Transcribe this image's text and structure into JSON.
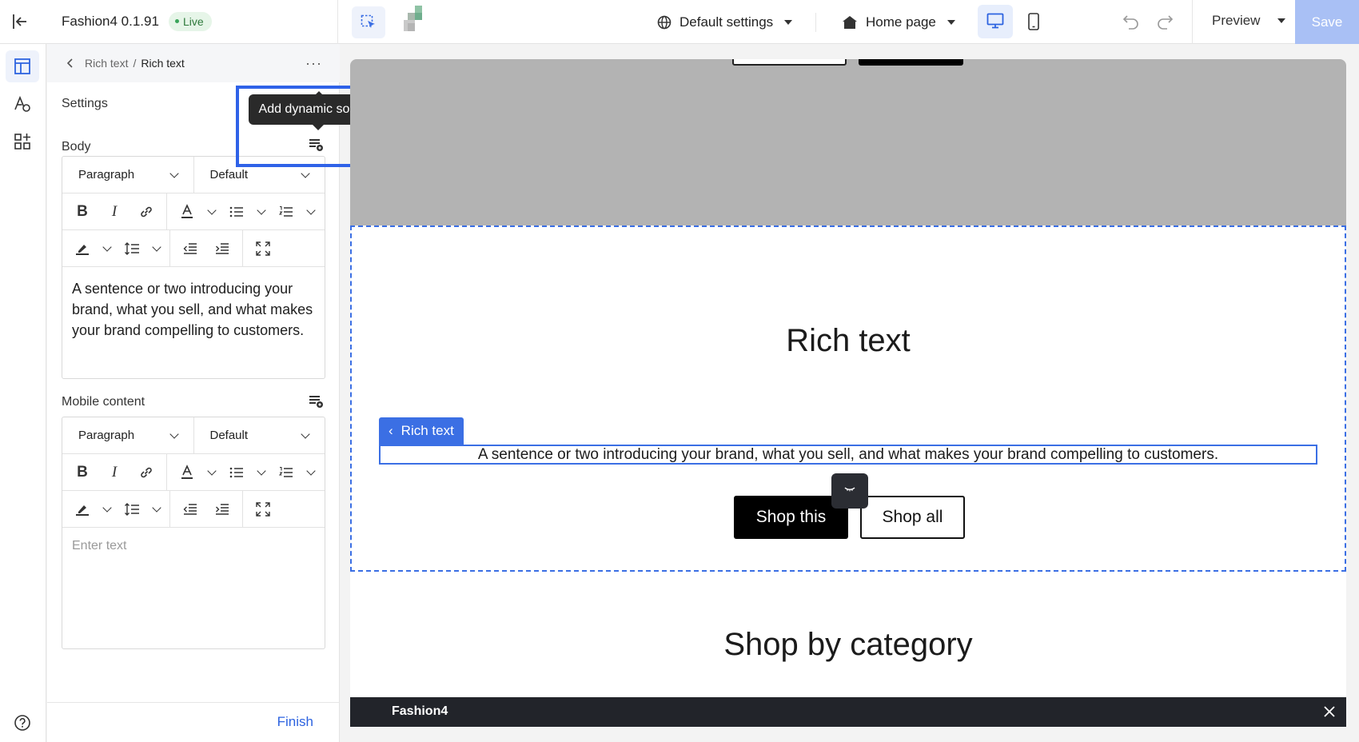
{
  "topbar": {
    "app_title": "Fashion4 0.1.91",
    "status_badge": "Live",
    "settings_dropdown": "Default settings",
    "page_dropdown": "Home page",
    "preview_label": "Preview",
    "save_label": "Save"
  },
  "panel": {
    "breadcrumb_parent": "Rich text",
    "breadcrumb_sep": "/",
    "breadcrumb_current": "Rich text",
    "more_label": "···",
    "settings_label": "Settings",
    "tooltip_text": "Add dynamic source",
    "body_label": "Body",
    "body_editor": {
      "block_type": "Paragraph",
      "style": "Default",
      "text": "A sentence or two introducing your brand, what you sell, and what makes your brand compelling to customers."
    },
    "mobile_label": "Mobile content",
    "mobile_editor": {
      "block_type": "Paragraph",
      "style": "Default",
      "placeholder": "Enter text"
    },
    "finish_label": "Finish"
  },
  "canvas": {
    "rich_text_heading": "Rich text",
    "block_tag": "Rich text",
    "rich_text_body": "A sentence or two introducing your brand, what you sell, and what makes your brand compelling to customers.",
    "primary_button": "Shop this",
    "secondary_button": "Shop all",
    "category_heading": "Shop by category"
  },
  "footer": {
    "title": "Fashion4"
  },
  "colors": {
    "accent": "#3b6fe4",
    "save_disabled": "#a9c0f5",
    "annotation_blue": "#2f62e8"
  },
  "icons": [
    "exit-icon",
    "sections-icon",
    "theme-styles-icon",
    "apps-icon",
    "help-icon",
    "select-tool-icon",
    "globe-icon",
    "home-icon",
    "desktop-icon",
    "mobile-icon",
    "undo-icon",
    "redo-icon",
    "dynamic-source-icon",
    "close-icon"
  ]
}
